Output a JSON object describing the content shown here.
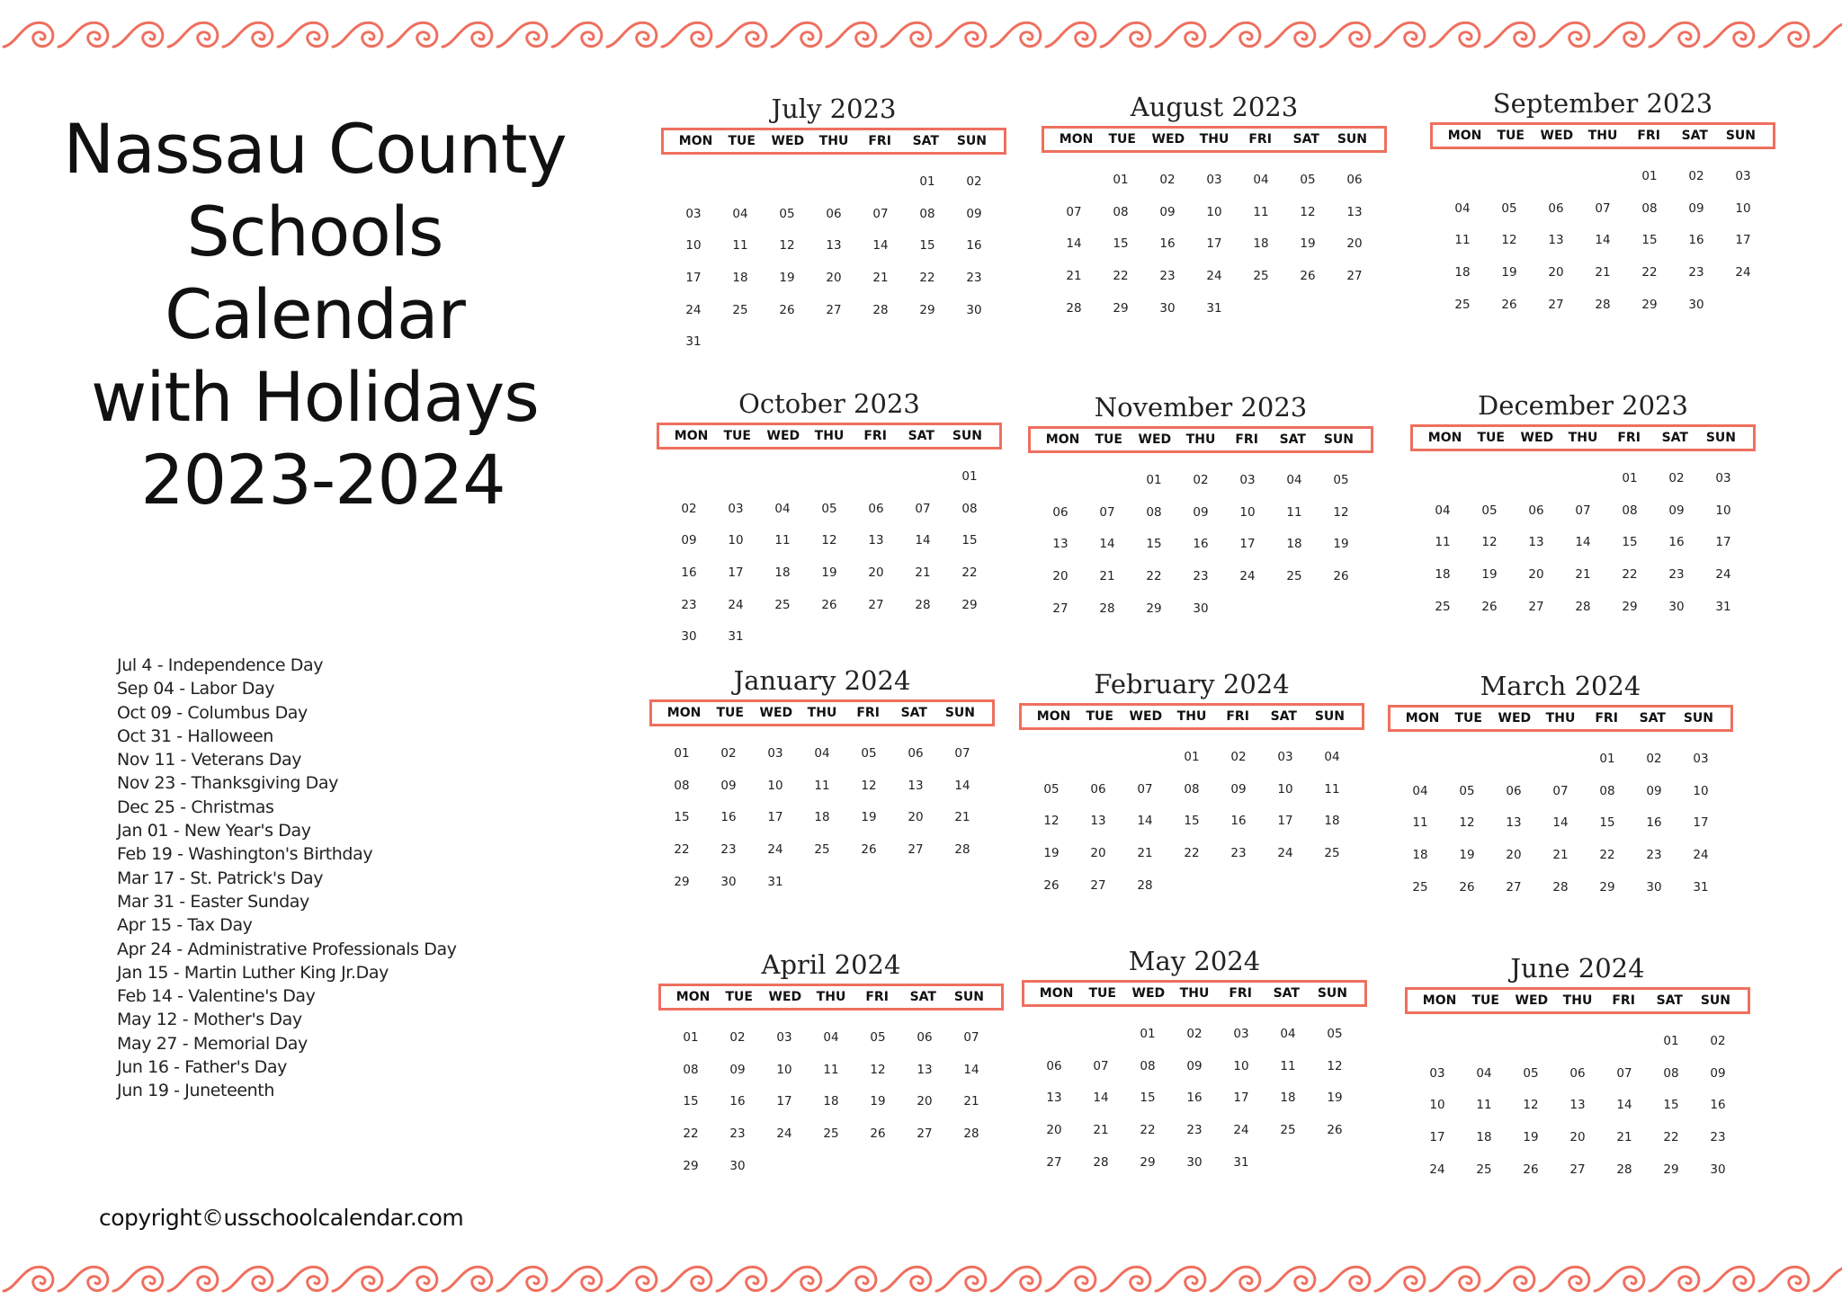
{
  "title_lines": [
    "Nassau County",
    "Schools Calendar",
    "with Holidays",
    "2023-2024"
  ],
  "weekday_labels": [
    "MON",
    "TUE",
    "WED",
    "THU",
    "FRI",
    "SAT",
    "SUN"
  ],
  "accent_color": "#ef6f5e",
  "months": [
    {
      "name": "July 2023",
      "offset": 5,
      "days": 31,
      "lastRowHint": 30
    },
    {
      "name": "August 2023",
      "offset": 1,
      "days": 31
    },
    {
      "name": "September 2023",
      "offset": 4,
      "days": 30
    },
    {
      "name": "October 2023",
      "offset": 6,
      "days": 31
    },
    {
      "name": "November 2023",
      "offset": 2,
      "days": 30
    },
    {
      "name": "December 2023",
      "offset": 4,
      "days": 31
    },
    {
      "name": "January 2024",
      "offset": 0,
      "days": 31
    },
    {
      "name": "February 2024",
      "offset": 3,
      "days": 28
    },
    {
      "name": "March 2024",
      "offset": 4,
      "days": 31
    },
    {
      "name": "April 2024",
      "offset": 0,
      "days": 30
    },
    {
      "name": "May 2024",
      "offset": 2,
      "days": 31
    },
    {
      "name": "June 2024",
      "offset": 5,
      "days": 30
    }
  ],
  "holidays": [
    "Jul 4 - Independence Day",
    "Sep 04 - Labor Day",
    "Oct 09 - Columbus Day",
    "Oct 31 - Halloween",
    "Nov 11 - Veterans Day",
    "Nov 23 - Thanksgiving Day",
    "Dec 25 - Christmas",
    "Jan 01 - New Year's Day",
    "Feb 19 - Washington's Birthday",
    "Mar 17 - St. Patrick's Day",
    "Mar 31 - Easter Sunday",
    "Apr 15 - Tax Day",
    "Apr 24 - Administrative Professionals Day",
    "Jan 15 - Martin Luther King Jr.Day",
    "Feb 14 - Valentine's Day",
    "May 12 - Mother's Day",
    "May 27 - Memorial Day",
    "Jun 16 - Father's Day",
    "Jun 19 - Juneteenth"
  ],
  "copyright": "copyright©usschoolcalendar.com"
}
